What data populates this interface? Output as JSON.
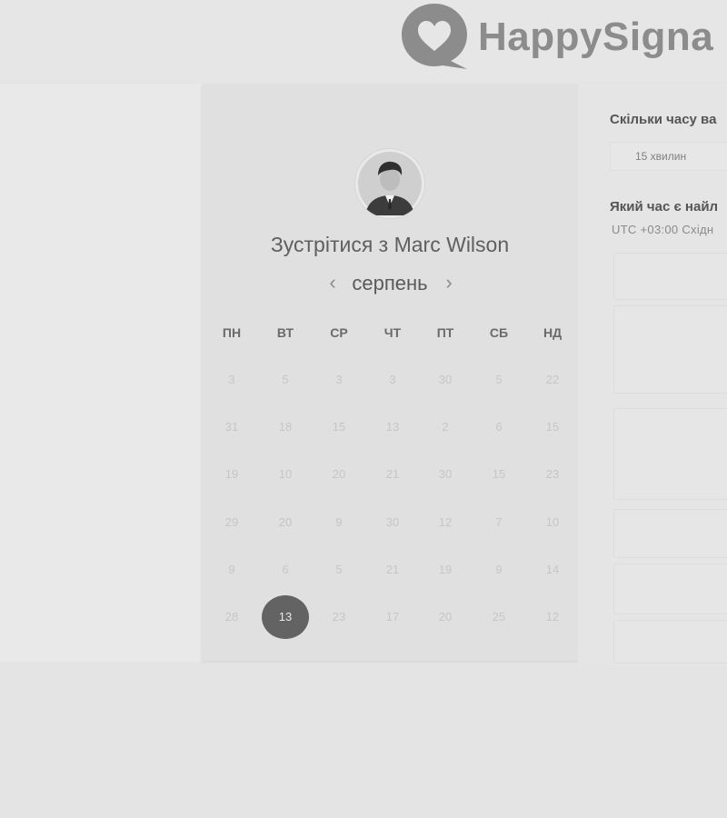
{
  "brand": {
    "name": "HappySigna"
  },
  "calendar": {
    "title_prefix": "Зустрітися з",
    "host_name": "Marc Wilson",
    "month": "серпень",
    "prev_icon": "chevron-left-icon",
    "next_icon": "chevron-right-icon",
    "weekdays": [
      "ПН",
      "ВТ",
      "СР",
      "ЧТ",
      "ПТ",
      "СБ",
      "НД"
    ],
    "weeks": [
      [
        "3",
        "5",
        "3",
        "3",
        "30",
        "5",
        "22"
      ],
      [
        "31",
        "18",
        "15",
        "13",
        "2",
        "6",
        "15"
      ],
      [
        "19",
        "10",
        "20",
        "21",
        "30",
        "15",
        "23"
      ],
      [
        "29",
        "20",
        "9",
        "30",
        "12",
        "7",
        "10"
      ],
      [
        "9",
        "6",
        "5",
        "21",
        "19",
        "9",
        "14"
      ],
      [
        "28",
        "13",
        "23",
        "17",
        "20",
        "25",
        "12"
      ]
    ],
    "selected_day": "13"
  },
  "booking": {
    "duration_question": "Скільки часу ва",
    "duration_value": "15 хвилин",
    "time_question": "Який час є найл",
    "timezone": "UTC +03:00 Східн"
  },
  "colors": {
    "background": "#e4e4e4",
    "card": "#e0e0e0",
    "selected_day": "#636363",
    "logo": "#8c8c8c"
  }
}
